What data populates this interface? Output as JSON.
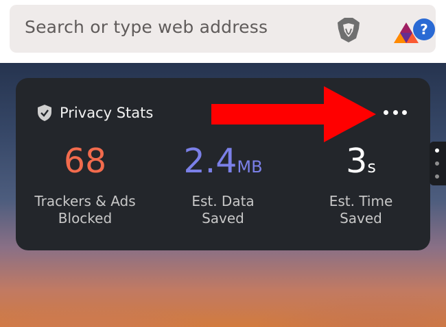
{
  "search": {
    "placeholder": "Search or type web address"
  },
  "icons": {
    "brave": "brave-lion-icon",
    "rewards": "bat-rewards-icon",
    "help_badge": "?"
  },
  "privacy_stats": {
    "title": "Privacy Stats",
    "menu_icon": "more-horizontal-icon",
    "stats": [
      {
        "value": "68",
        "unit": "",
        "label_line1": "Trackers & Ads",
        "label_line2": "Blocked",
        "color": "#f26b4d"
      },
      {
        "value": "2.4",
        "unit": "MB",
        "label_line1": "Est. Data",
        "label_line2": "Saved",
        "color": "#7b80e8"
      },
      {
        "value": "3",
        "unit": "s",
        "label_line1": "Est. Time",
        "label_line2": "Saved",
        "color": "#ffffff"
      }
    ]
  },
  "annotation": {
    "arrow_color": "#ff0000"
  },
  "pager": {
    "dots": 3,
    "active_index": 0
  }
}
